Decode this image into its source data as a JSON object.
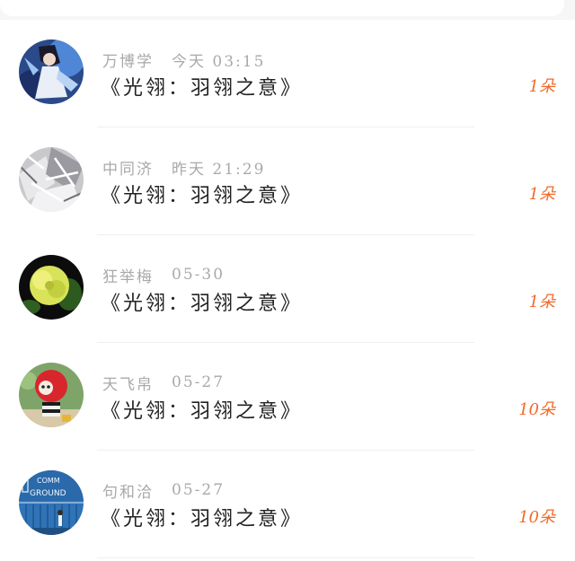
{
  "items": [
    {
      "user": "万博学",
      "time": "今天 03:15",
      "title": "《光翎：羽翎之意》",
      "count": "1朵",
      "avatar": "anime-character-avatar"
    },
    {
      "user": "中同济",
      "time": "昨天 21:29",
      "title": "《光翎：羽翎之意》",
      "count": "1朵",
      "avatar": "ice-crystal-avatar"
    },
    {
      "user": "狂举梅",
      "time": "05-30",
      "title": "《光翎：羽翎之意》",
      "count": "1朵",
      "avatar": "yellow-flower-avatar"
    },
    {
      "user": "天飞帛",
      "time": "05-27",
      "title": "《光翎：羽翎之意》",
      "count": "10朵",
      "avatar": "red-doll-avatar"
    },
    {
      "user": "句和洽",
      "time": "05-27",
      "title": "《光翎：羽翎之意》",
      "count": "10朵",
      "avatar": "container-ground-avatar"
    }
  ],
  "avatar_texts": {
    "line1": "COMM",
    "line2": "GROUND"
  },
  "colors": {
    "count": "#f06a2a",
    "meta": "#a9a9a9",
    "title": "#222222"
  }
}
